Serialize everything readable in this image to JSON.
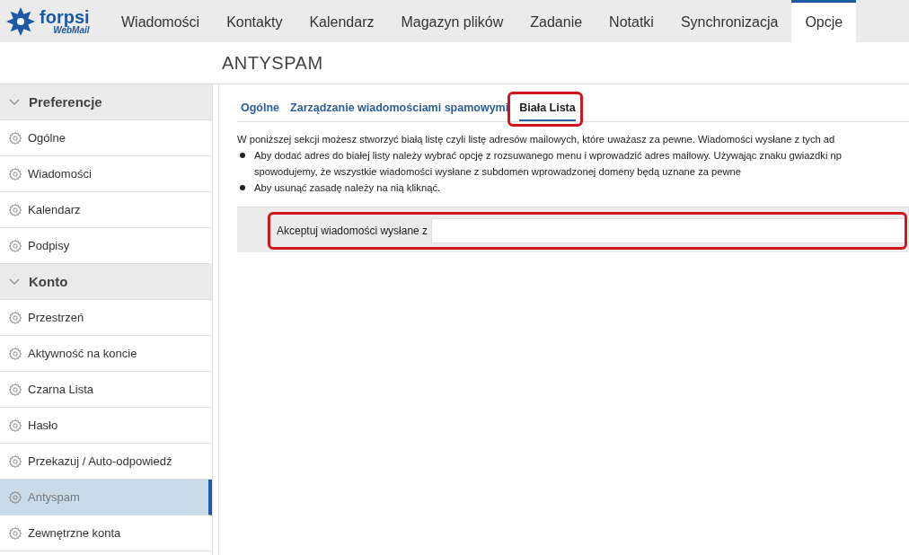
{
  "logo": {
    "name": "forpsi",
    "sub": "WebMail"
  },
  "nav": [
    {
      "label": "Wiadomości",
      "selected": false
    },
    {
      "label": "Kontakty",
      "selected": false
    },
    {
      "label": "Kalendarz",
      "selected": false
    },
    {
      "label": "Magazyn plików",
      "selected": false
    },
    {
      "label": "Zadanie",
      "selected": false
    },
    {
      "label": "Notatki",
      "selected": false
    },
    {
      "label": "Synchronizacja",
      "selected": false
    },
    {
      "label": "Opcje",
      "selected": true
    }
  ],
  "page_title": "ANTYSPAM",
  "sidebar": [
    {
      "title": "Preferencje",
      "expanded": true,
      "items": [
        {
          "label": "Ogólne",
          "selected": false
        },
        {
          "label": "Wiadomości",
          "selected": false
        },
        {
          "label": "Kalendarz",
          "selected": false
        },
        {
          "label": "Podpisy",
          "selected": false
        }
      ]
    },
    {
      "title": "Konto",
      "expanded": true,
      "items": [
        {
          "label": "Przestrzeń",
          "selected": false
        },
        {
          "label": "Aktywność na koncie",
          "selected": false
        },
        {
          "label": "Czarna Lista",
          "selected": false
        },
        {
          "label": "Hasło",
          "selected": false
        },
        {
          "label": "Przekazuj / Auto-odpowiedź",
          "selected": false
        },
        {
          "label": "Antyspam",
          "selected": true
        },
        {
          "label": "Zewnętrzne konta",
          "selected": false
        }
      ]
    }
  ],
  "tabs": [
    {
      "label": "Ogólne",
      "selected": false,
      "highlighted": false
    },
    {
      "label": "Zarządzanie wiadomościami spamowymi",
      "selected": false,
      "highlighted": false
    },
    {
      "label": "Biała Lista",
      "selected": true,
      "highlighted": true
    }
  ],
  "intro": "W poniższej sekcji możesz stworzyć białą listę czyli listę adresów mailowych, które uważasz za pewne. Wiadomości wysłane z tych ad",
  "bullets": [
    {
      "lines": [
        "Aby dodać adres do białej listy należy wybrać opcję z rozsuwanego menu i wprowadzić adres mailowy. Używając znaku gwiazdki np",
        "spowodujemy, że wszystkie wiadomości wysłane z subdomen wprowadzonej domeny będą uznane za pewne"
      ]
    },
    {
      "lines": [
        "Aby usunąć zasadę należy na nią kliknąć."
      ]
    }
  ],
  "form": {
    "label": "Akceptuj wiadomości wysłane z",
    "highlighted": true
  }
}
